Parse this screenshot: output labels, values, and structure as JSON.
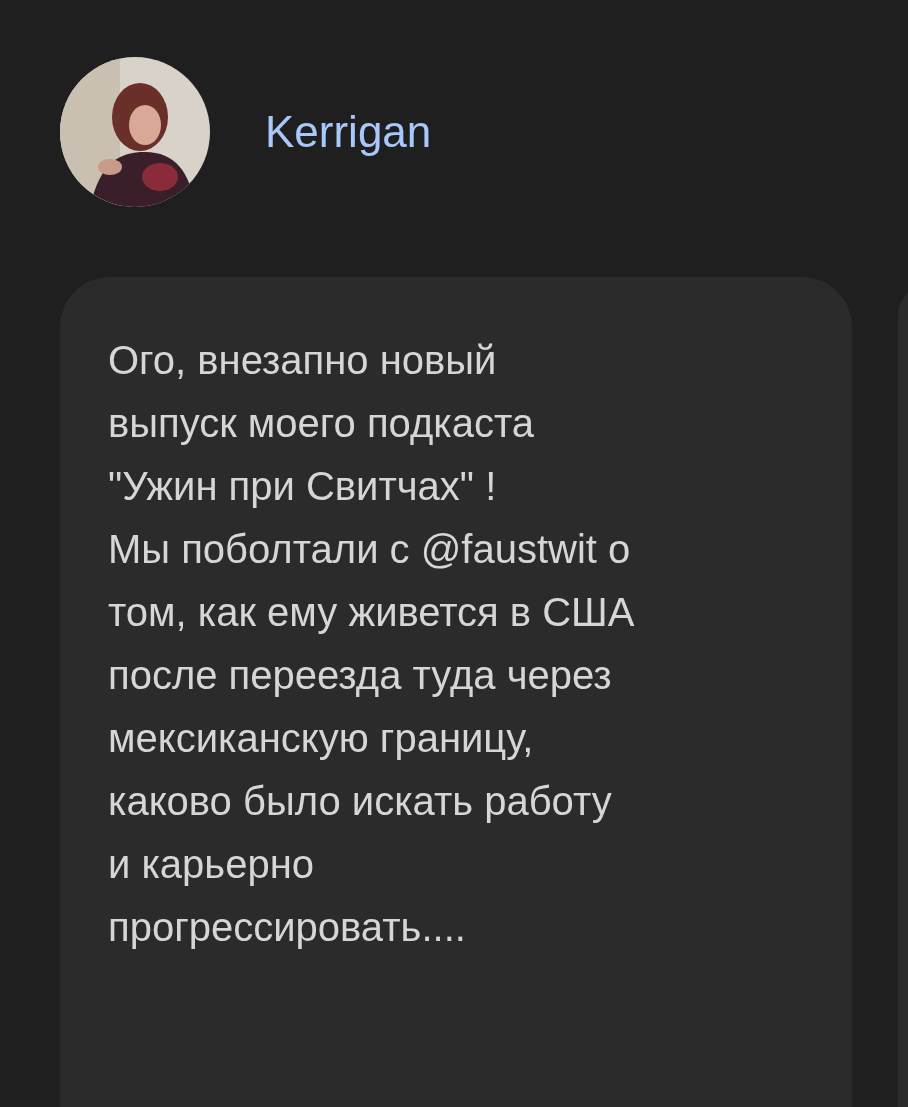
{
  "post": {
    "author": "Kerrigan",
    "text": "Ого, внезапно новый\nвыпуск моего подкаста\n\"Ужин при Свитчах\" !\nМы поболтали с @faustwit о\nтом, как ему живется в США\nпосле переезда туда через\nмексиканскую границу,\nкаково было искать работу\nи карьерно\nпрогрессировать...."
  }
}
